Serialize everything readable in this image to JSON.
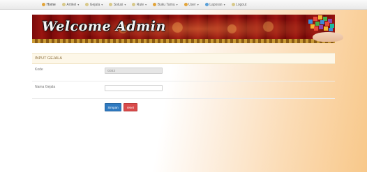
{
  "nav": {
    "items": [
      {
        "label": "Home",
        "has_caret": false,
        "icon": "home-icon",
        "color": "#e2a43a"
      },
      {
        "label": "Artikel",
        "has_caret": true,
        "icon": "article-icon",
        "color": "#d8c98a"
      },
      {
        "label": "Gejala",
        "has_caret": true,
        "icon": "symptom-icon",
        "color": "#d8c98a"
      },
      {
        "label": "Solusi",
        "has_caret": true,
        "icon": "solution-icon",
        "color": "#d8c98a"
      },
      {
        "label": "Rule",
        "has_caret": true,
        "icon": "rule-icon",
        "color": "#d8c98a"
      },
      {
        "label": "Buku Tamu",
        "has_caret": true,
        "icon": "guestbook-icon",
        "color": "#e2a43a"
      },
      {
        "label": "User",
        "has_caret": true,
        "icon": "user-icon",
        "color": "#e2a43a"
      },
      {
        "label": "Laporan",
        "has_caret": true,
        "icon": "report-icon",
        "color": "#5aa0d8"
      },
      {
        "label": "Logout",
        "has_caret": false,
        "icon": "logout-icon",
        "color": "#d8c98a"
      }
    ],
    "caret": "▾"
  },
  "banner": {
    "title": "Welcome Admin"
  },
  "form": {
    "heading": "INPUT GEJALA",
    "kode_label": "Kode",
    "kode_value": "G043",
    "nama_label": "Nama Gejala",
    "nama_value": "",
    "simpan_label": "Simpan",
    "reset_label": "reset"
  },
  "colors": {
    "primary": "#2f7ac1",
    "danger": "#d94b4b",
    "banner": "#8a0d0d"
  }
}
